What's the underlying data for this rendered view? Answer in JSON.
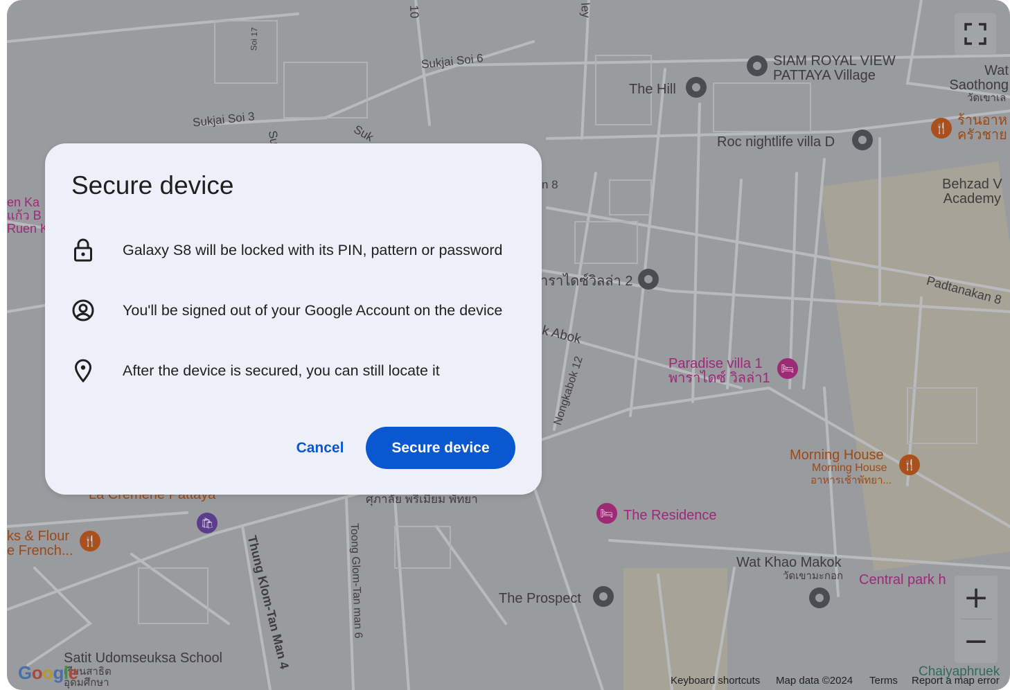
{
  "dialog": {
    "title": "Secure device",
    "items": [
      {
        "icon": "lock-icon",
        "text": "Galaxy S8 will be locked with its PIN, pattern or password"
      },
      {
        "icon": "account-circle-icon",
        "text": "You'll be signed out of your Google Account on the device"
      },
      {
        "icon": "location-pin-icon",
        "text": "After the device is secured, you can still locate it"
      }
    ],
    "cancel_label": "Cancel",
    "confirm_label": "Secure device"
  },
  "map": {
    "places": {
      "siam_royal": "SIAM ROYAL VIEW\nPATTAYA Village",
      "the_hill": "The Hill",
      "roc_nightlife": "Roc nightlife villa D",
      "wat_saothong": "Wat\nSaothong",
      "wat_saothong_th": "วัดเขาเล",
      "restaurant_th": "ร้านอาห\nครัวชาย",
      "behzad": "Behzad V\nAcademy",
      "paradise_villa_2_th": "าราไดซ์วิลล่า 2",
      "paradise_villa_1": "Paradise villa 1",
      "paradise_villa_1_th": "พาราไดซ์ วิลล่า1",
      "morning_house": "Morning House",
      "morning_house_sub": "Morning House",
      "morning_house_th": "อาหารเช้าพัทยา...",
      "the_residence": "The Residence",
      "wat_khao_makok": "Wat Khao Makok",
      "wat_khao_makok_th": "วัดเขามะกอก",
      "central_park": "Central park h",
      "the_prospect": "The Prospect",
      "satit_school": "Satit Udomseuksa School",
      "satit_school_th": "เรียนสาธิต\nอุดมศึกษา",
      "la_cremerie": "La Cremerie Pattaya",
      "school_th": "ศุภาลัย พรีเมี่ยม พัทยา",
      "flour_french": "ks & Flour\ne French...",
      "left_edge": "en Ka\nแก้ว B\nRuen K",
      "chaiyaphruek": "Chaiyaphruek"
    },
    "streets": {
      "sukjai_soi6": "Sukjai Soi 6",
      "sukjai_soi3": "Sukjai Soi 3",
      "soi17": "Soi 17",
      "soi10": "10",
      "ley": "ley",
      "su": "Su",
      "suk": "Suk",
      "n8": "n 8",
      "padtanakan8": "Padtanakan 8",
      "k_abok": "k Abok",
      "nongkabok12": "Nongkabok 12",
      "thung_klom": "Thung Klom-Tan Man 4",
      "toong_glom": "Toong Glom-Tan man 6"
    },
    "footer": {
      "keyboard": "Keyboard shortcuts",
      "map_data": "Map data ©2024",
      "terms": "Terms",
      "report": "Report a map error"
    },
    "logo": "Google",
    "zoom_in": "+",
    "zoom_out": "−"
  }
}
